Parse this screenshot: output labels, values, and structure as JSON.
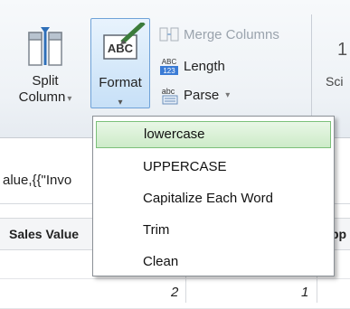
{
  "ribbon": {
    "split_column": {
      "line1": "Split",
      "line2": "Column"
    },
    "format": {
      "label": "Format"
    },
    "merge_columns": {
      "label": "Merge Columns"
    },
    "length": {
      "label": "Length"
    },
    "parse": {
      "label": "Parse"
    },
    "cut_number": "1",
    "cut_text": "Sci"
  },
  "formula_bar": {
    "text": "alue,{{\"Invo"
  },
  "grid": {
    "headers": {
      "sales_value": "Sales Value",
      "partial": "pp"
    },
    "rows": [
      {
        "a": "",
        "b": ""
      },
      {
        "a": "2",
        "b": "1"
      }
    ]
  },
  "format_menu": {
    "items": [
      {
        "label": "lowercase",
        "highlighted": true
      },
      {
        "label": "UPPERCASE",
        "highlighted": false
      },
      {
        "label": "Capitalize Each Word",
        "highlighted": false
      },
      {
        "label": "Trim",
        "highlighted": false
      },
      {
        "label": "Clean",
        "highlighted": false
      }
    ]
  },
  "icons": {
    "split_column": "split-column-icon",
    "format": "format-abc-pencil-icon",
    "merge_columns": "merge-columns-icon",
    "length": "length-abc-123-icon",
    "parse": "parse-abc-icon"
  },
  "colors": {
    "accent_blue": "#6fa2d8",
    "menu_highlight": "#cdebc8",
    "menu_highlight_border": "#7cc07a"
  }
}
